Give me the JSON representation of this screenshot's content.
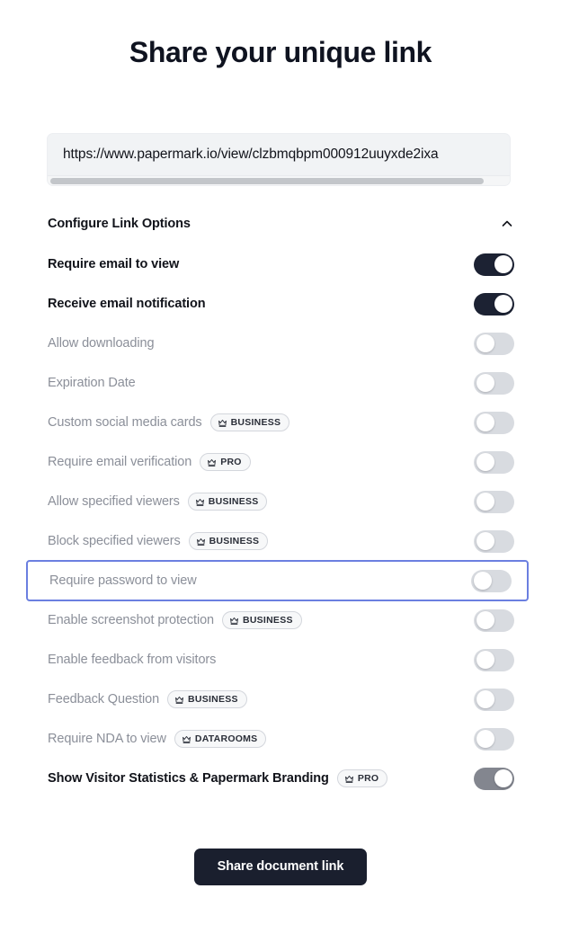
{
  "page": {
    "title": "Share your unique link",
    "background_color": "#ffffff"
  },
  "link_field": {
    "name": "share-link-input",
    "value": "https://www.papermark.io/view/clzbmqbpm000912uuyxde2ixa",
    "placeholder": "https://www.papermark.io/view/...",
    "readonly": true,
    "has_horizontal_scrollbar": true
  },
  "section": {
    "label": "Configure Link Options",
    "expanded": true,
    "chevron_icon": "chevron-up-icon"
  },
  "colors": {
    "toggle_on": "#1c2233",
    "toggle_on_muted": "#83868f",
    "toggle_off": "#d8dbe0",
    "highlight_border": "#6b7fe0",
    "text_active": "#11131a",
    "text_disabled": "#8b8f99",
    "button_bg": "#1a1f2e",
    "input_bg": "#f1f3f5"
  },
  "options": [
    {
      "label": "Require email to view",
      "badge": null,
      "toggle_state": "on",
      "disabled": false,
      "highlighted": false
    },
    {
      "label": "Receive email notification",
      "badge": null,
      "toggle_state": "on",
      "disabled": false,
      "highlighted": false
    },
    {
      "label": "Allow downloading",
      "badge": null,
      "toggle_state": "off",
      "disabled": true,
      "highlighted": false
    },
    {
      "label": "Expiration Date",
      "badge": null,
      "toggle_state": "off",
      "disabled": true,
      "highlighted": false
    },
    {
      "label": "Custom social media cards",
      "badge": "BUSINESS",
      "toggle_state": "off",
      "disabled": true,
      "highlighted": false
    },
    {
      "label": "Require email verification",
      "badge": "PRO",
      "toggle_state": "off",
      "disabled": true,
      "highlighted": false
    },
    {
      "label": "Allow specified viewers",
      "badge": "BUSINESS",
      "toggle_state": "off",
      "disabled": true,
      "highlighted": false
    },
    {
      "label": "Block specified viewers",
      "badge": "BUSINESS",
      "toggle_state": "off",
      "disabled": true,
      "highlighted": false
    },
    {
      "label": "Require password to view",
      "badge": null,
      "toggle_state": "off",
      "disabled": true,
      "highlighted": true
    },
    {
      "label": "Enable screenshot protection",
      "badge": "BUSINESS",
      "toggle_state": "off",
      "disabled": true,
      "highlighted": false
    },
    {
      "label": "Enable feedback from visitors",
      "badge": null,
      "toggle_state": "off",
      "disabled": true,
      "highlighted": false
    },
    {
      "label": "Feedback Question",
      "badge": "BUSINESS",
      "toggle_state": "off",
      "disabled": true,
      "highlighted": false
    },
    {
      "label": "Require NDA to view",
      "badge": "DATAROOMS",
      "toggle_state": "off",
      "disabled": true,
      "highlighted": false
    },
    {
      "label": "Show Visitor Statistics & Papermark Branding",
      "badge": "PRO",
      "toggle_state": "on-muted",
      "disabled": false,
      "highlighted": false
    }
  ],
  "footer": {
    "submit_label": "Share document link"
  }
}
